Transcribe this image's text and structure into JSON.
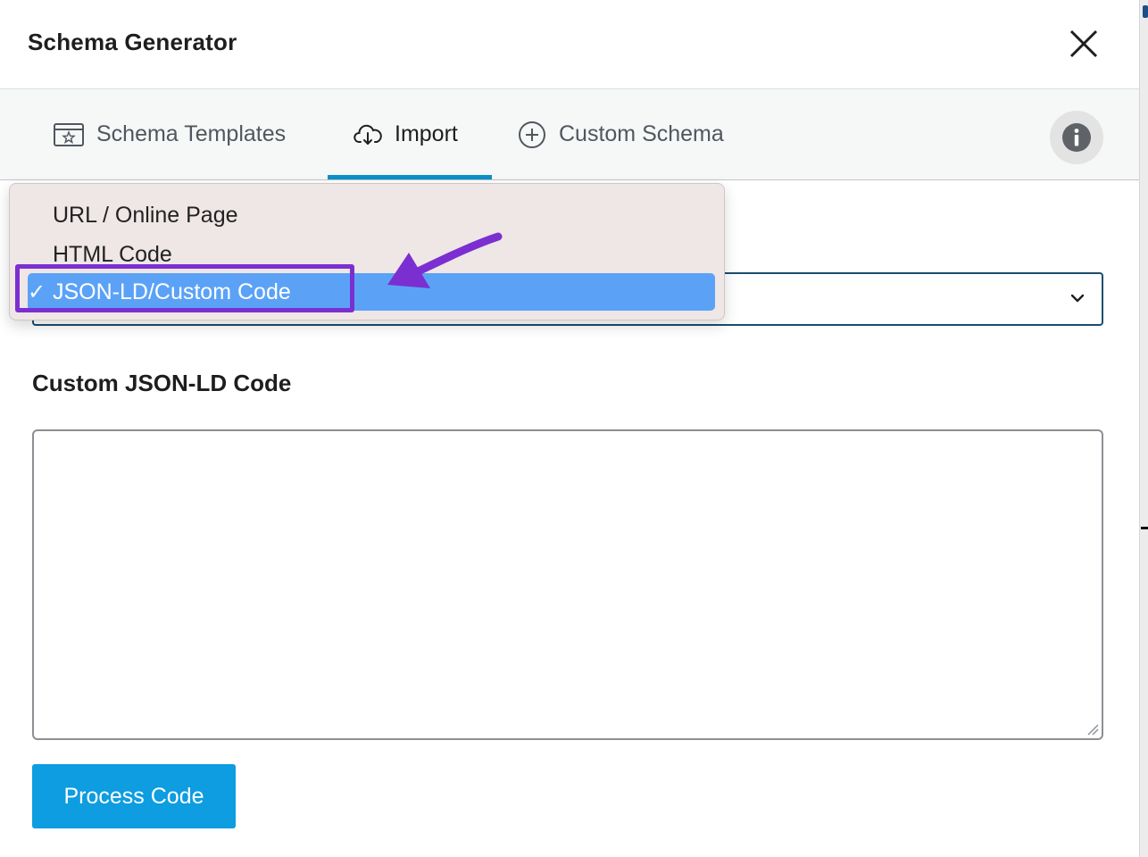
{
  "modal": {
    "title": "Schema Generator"
  },
  "tabs": [
    {
      "label": "Schema Templates",
      "icon": "template-icon",
      "active": false
    },
    {
      "label": "Import",
      "icon": "cloud-download-icon",
      "active": true
    },
    {
      "label": "Custom Schema",
      "icon": "plus-circle-icon",
      "active": false
    }
  ],
  "dropdown": {
    "options": [
      {
        "label": "URL / Online Page",
        "selected": false
      },
      {
        "label": "HTML Code",
        "selected": false
      },
      {
        "label": "JSON-LD/Custom Code",
        "selected": true
      }
    ],
    "check_mark": "✓"
  },
  "form": {
    "code_label": "Custom JSON-LD Code",
    "code_value": "",
    "submit_label": "Process Code"
  },
  "colors": {
    "accent": "#0d9de0",
    "tab_underline": "#0a91c7",
    "selected_option": "#5ba2f7",
    "annotation": "#7b2fd0"
  }
}
